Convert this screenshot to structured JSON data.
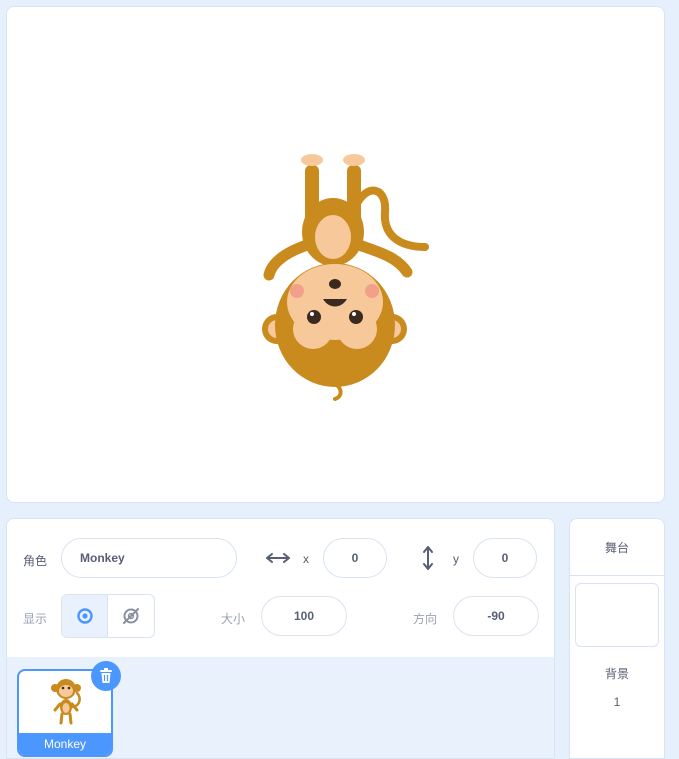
{
  "sprite_info": {
    "sprite_label": "角色",
    "sprite_name": "Monkey",
    "x_label": "x",
    "x_value": "0",
    "y_label": "y",
    "y_value": "0",
    "show_label": "显示",
    "size_label": "大小",
    "size_value": "100",
    "direction_label": "方向",
    "direction_value": "-90"
  },
  "sprite_list": [
    {
      "name": "Monkey",
      "selected": true
    }
  ],
  "stage_panel": {
    "title": "舞台",
    "backdrop_label": "背景",
    "backdrop_count": "1"
  },
  "colors": {
    "accent": "#4c97ff",
    "text": "#575e75",
    "background": "#e6f0fc"
  },
  "icons": [
    "x-arrows-icon",
    "y-arrows-icon",
    "eye-icon",
    "eye-slash-icon",
    "trash-icon",
    "monkey-sprite"
  ]
}
